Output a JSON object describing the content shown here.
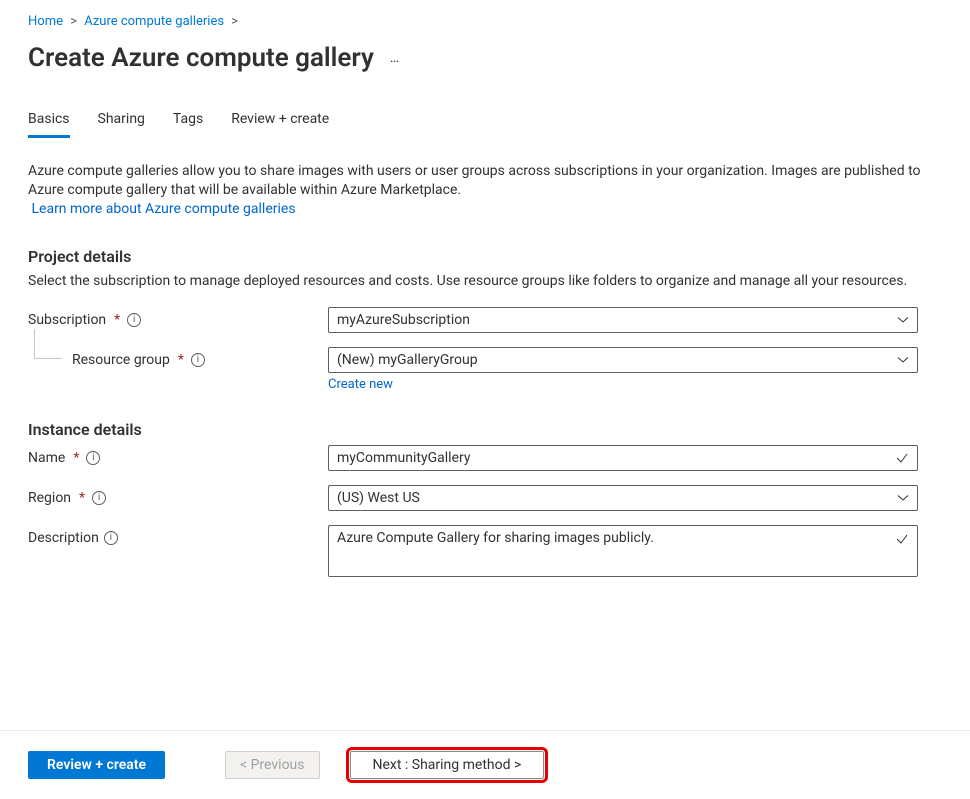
{
  "breadcrumb": [
    {
      "label": "Home"
    },
    {
      "label": "Azure compute galleries"
    }
  ],
  "title": "Create Azure compute gallery",
  "more_icon": "…",
  "tabs": [
    {
      "id": "basics",
      "label": "Basics",
      "active": true
    },
    {
      "id": "sharing",
      "label": "Sharing",
      "active": false
    },
    {
      "id": "tags",
      "label": "Tags",
      "active": false
    },
    {
      "id": "review",
      "label": "Review + create",
      "active": false
    }
  ],
  "intro_text": "Azure compute galleries allow you to share images with users or user groups across subscriptions in your organization. Images are published to Azure compute gallery that will be available within Azure Marketplace.",
  "intro_link": "Learn more about Azure compute galleries",
  "sections": {
    "project_details": {
      "heading": "Project details",
      "desc": "Select the subscription to manage deployed resources and costs. Use resource groups like folders to organize and manage all your resources.",
      "subscription_label": "Subscription",
      "subscription_value": "myAzureSubscription",
      "resource_group_label": "Resource group",
      "resource_group_value": "(New) myGalleryGroup",
      "create_new": "Create new"
    },
    "instance_details": {
      "heading": "Instance details",
      "name_label": "Name",
      "name_value": "myCommunityGallery",
      "region_label": "Region",
      "region_value": "(US) West US",
      "description_label": "Description",
      "description_value": "Azure Compute Gallery for sharing images publicly."
    }
  },
  "footer": {
    "review_create": "Review + create",
    "previous": "< Previous",
    "next": "Next : Sharing method >"
  }
}
